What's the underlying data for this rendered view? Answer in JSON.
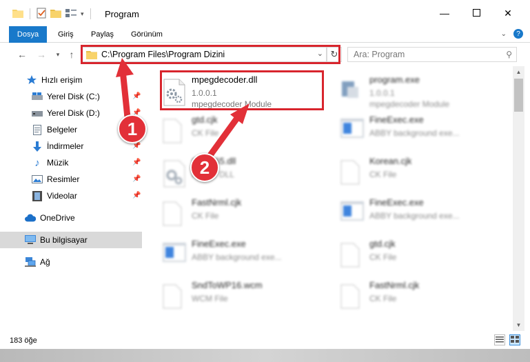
{
  "window": {
    "title": "Program"
  },
  "ribbon": {
    "tabs": [
      {
        "label": "Dosya"
      },
      {
        "label": "Giriş"
      },
      {
        "label": "Paylaş"
      },
      {
        "label": "Görünüm"
      }
    ]
  },
  "nav": {
    "address_path": "C:\\Program Files\\Program Dizini",
    "search_placeholder": "Ara: Program"
  },
  "sidebar": {
    "items": [
      {
        "label": "Hızlı erişim",
        "icon": "star-icon"
      },
      {
        "label": "Yerel Disk (C:)",
        "icon": "drive-icon"
      },
      {
        "label": "Yerel Disk (D:)",
        "icon": "drive-icon"
      },
      {
        "label": "Belgeler",
        "icon": "document-icon"
      },
      {
        "label": "İndirmeler",
        "icon": "download-icon"
      },
      {
        "label": "Müzik",
        "icon": "music-icon"
      },
      {
        "label": "Resimler",
        "icon": "picture-icon"
      },
      {
        "label": "Videolar",
        "icon": "video-icon"
      },
      {
        "label": "OneDrive",
        "icon": "cloud-icon"
      },
      {
        "label": "Bu bilgisayar",
        "icon": "computer-icon"
      },
      {
        "label": "Ağ",
        "icon": "network-icon"
      }
    ]
  },
  "files": [
    {
      "name": "mpegdecoder.dll",
      "line2": "1.0.0.1",
      "line3": "mpegdecoder Module",
      "icon": "dll-gear-icon"
    },
    {
      "name": "program.exe",
      "line2": "1.0.0.1",
      "line3": "mpegdecoder Module",
      "icon": "exe-icon"
    },
    {
      "name": "gtd.cjk",
      "line2": "CK File",
      "line3": "",
      "icon": "blank-file-icon"
    },
    {
      "name": "FineExec.exe",
      "line2": "ABBY background exe...",
      "line3": "",
      "icon": "app-window-icon"
    },
    {
      "name": "Client65.dll",
      "line2": "Device DLL",
      "line3": "",
      "icon": "dll-gear-icon"
    },
    {
      "name": "Korean.cjk",
      "line2": "CK File",
      "line3": "",
      "icon": "blank-file-icon"
    },
    {
      "name": "FastNrml.cjk",
      "line2": "CK File",
      "line3": "",
      "icon": "blank-file-icon"
    },
    {
      "name": "FineExec.exe",
      "line2": "ABBY background exe...",
      "line3": "",
      "icon": "app-window-icon"
    },
    {
      "name": "FineExec.exe",
      "line2": "ABBY background exe...",
      "line3": "",
      "icon": "app-window-icon"
    },
    {
      "name": "gtd.cjk",
      "line2": "CK File",
      "line3": "",
      "icon": "blank-file-icon"
    },
    {
      "name": "SndToWP16.wcm",
      "line2": "WCM File",
      "line3": "",
      "icon": "blank-file-icon"
    },
    {
      "name": "FastNrml.cjk",
      "line2": "CK File",
      "line3": "",
      "icon": "blank-file-icon"
    }
  ],
  "status": {
    "item_count": "183 öğe"
  },
  "annotations": {
    "badge1": "1",
    "badge2": "2",
    "color": "#e23038"
  },
  "colors": {
    "file_tab": "#1979ca",
    "highlight": "#d8252d",
    "selected_sidebar": "#d9d9d9"
  }
}
